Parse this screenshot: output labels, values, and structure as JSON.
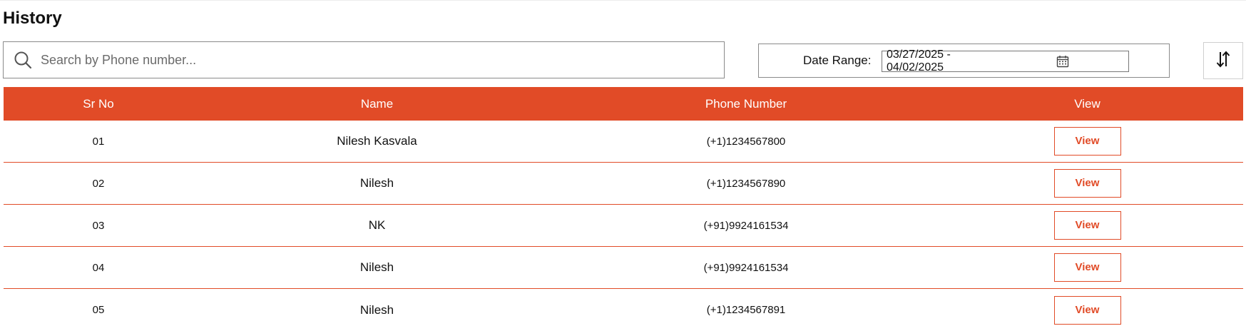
{
  "page": {
    "title": "History"
  },
  "search": {
    "placeholder": "Search by Phone number...",
    "value": "",
    "icon": "search-icon"
  },
  "date_range": {
    "label": "Date Range:",
    "value": "03/27/2025 - 04/02/2025",
    "icon": "calendar-icon"
  },
  "sort": {
    "icon": "sort-icon"
  },
  "colors": {
    "accent": "#e14b27"
  },
  "table": {
    "headers": {
      "sr_no": "Sr No",
      "name": "Name",
      "phone": "Phone Number",
      "view": "View"
    },
    "rows": [
      {
        "sr_no": "01",
        "name": "Nilesh Kasvala",
        "phone": "(+1)1234567800",
        "action": "View"
      },
      {
        "sr_no": "02",
        "name": "Nilesh",
        "phone": "(+1)1234567890",
        "action": "View"
      },
      {
        "sr_no": "03",
        "name": "NK",
        "phone": "(+91)9924161534",
        "action": "View"
      },
      {
        "sr_no": "04",
        "name": "Nilesh",
        "phone": "(+91)9924161534",
        "action": "View"
      },
      {
        "sr_no": "05",
        "name": "Nilesh",
        "phone": "(+1)1234567891",
        "action": "View"
      }
    ]
  }
}
